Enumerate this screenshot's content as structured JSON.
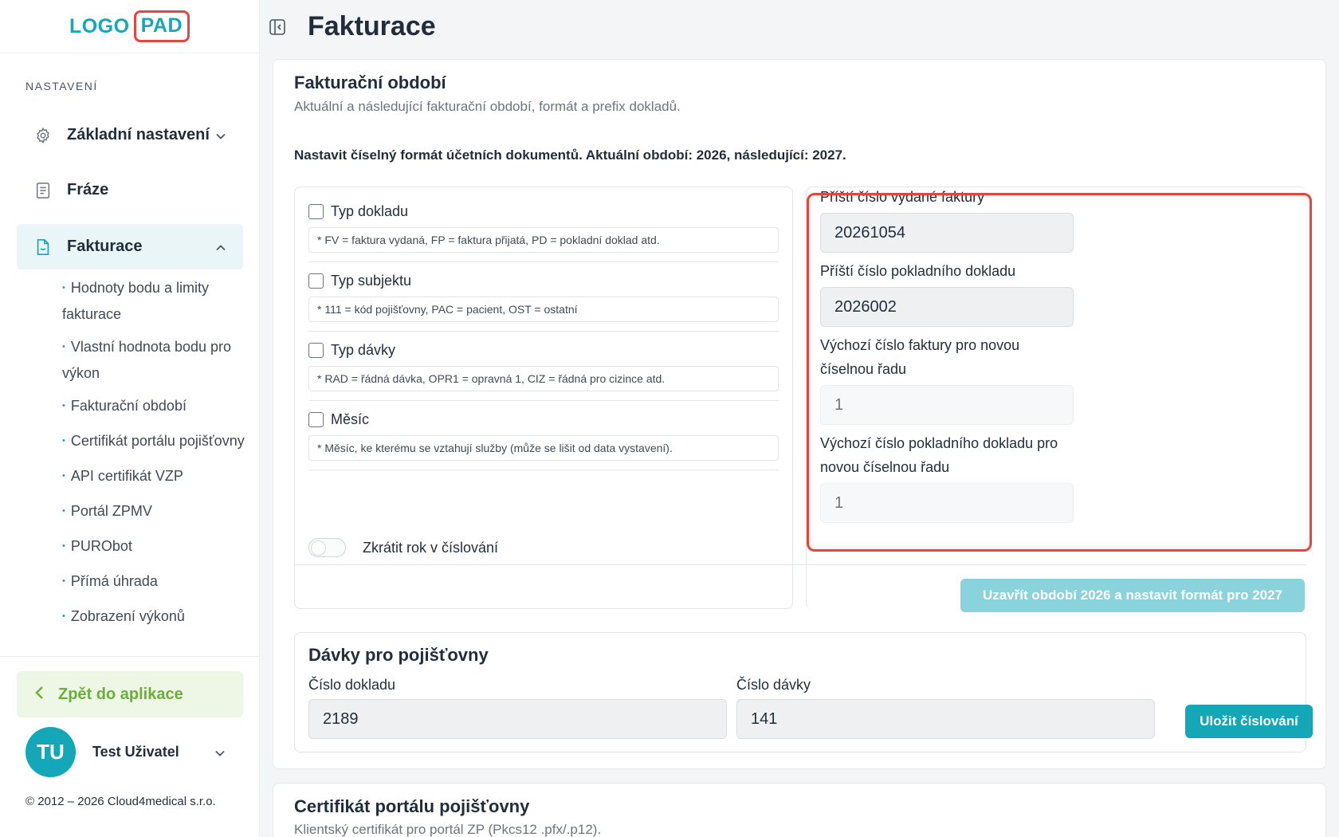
{
  "logo": {
    "part1": "LOGO",
    "part2": "PAD"
  },
  "sidebar": {
    "section_label": "NASTAVENÍ",
    "items": [
      {
        "label": "Základní nastavení",
        "icon": "gear-icon",
        "chevron": "chevron-down-icon"
      },
      {
        "label": "Fráze",
        "icon": "document-icon"
      },
      {
        "label": "Fakturace",
        "icon": "invoice-icon",
        "chevron": "chevron-up-icon",
        "active": true
      }
    ],
    "subitems": [
      "Hodnoty bodu a limity fakturace",
      "Vlastní hodnota bodu pro výkon",
      "Fakturační období",
      "Certifikát portálu pojišťovny",
      "API certifikát VZP",
      "Portál ZPMV",
      "PURObot",
      "Přímá úhrada",
      "Zobrazení výkonů"
    ],
    "back_label": "Zpět do aplikace",
    "user": {
      "initials": "TU",
      "name": "Test Uživatel"
    },
    "copyright": "© 2012 – 2026 Cloud4medical s.r.o."
  },
  "header": {
    "title": "Fakturace"
  },
  "period": {
    "title": "Fakturační období",
    "subtitle": "Aktuální a následující fakturační období, formát a prefix dokladů.",
    "note": "Nastavit číselný formát účetních dokumentů. Aktuální období: 2026, následující: 2027.",
    "format_options": [
      {
        "title": "Typ dokladu",
        "hint": "* FV = faktura vydaná, FP = faktura přijatá, PD = pokladní doklad atd.",
        "checked": false
      },
      {
        "title": "Typ subjektu",
        "hint": "* 111 = kód pojišťovny, PAC = pacient, OST = ostatní",
        "checked": false
      },
      {
        "title": "Typ dávky",
        "hint": "* RAD = řádná dávka, OPR1 = opravná 1, CIZ = řádná pro cizince atd.",
        "checked": false
      },
      {
        "title": "Měsíc",
        "hint": "* Měsíc, ke kterému se vztahují služby (může se lišit od data vystavení).",
        "checked": false
      }
    ],
    "toggle_label": "Zkrátit rok v číslování",
    "toggle_on": false,
    "numbers": {
      "next_invoice_label": "Příští číslo vydané faktury",
      "next_invoice_value": "20261054",
      "next_receipt_label": "Příští číslo pokladního dokladu",
      "next_receipt_value": "2026002",
      "default_invoice_label_1": "Výchozí číslo faktury pro novou",
      "default_invoice_label_2": "číselnou řadu",
      "default_invoice_placeholder": "1",
      "default_receipt_label_1": "Výchozí číslo pokladního dokladu pro",
      "default_receipt_label_2": "novou číselnou řadu",
      "default_receipt_placeholder": "1"
    },
    "close_button": "Uzavřít období 2026 a nastavit formát pro 2027"
  },
  "batches": {
    "title": "Dávky pro pojišťovny",
    "doc_number_label": "Číslo dokladu",
    "doc_number_value": "2189",
    "batch_number_label": "Číslo dávky",
    "batch_number_value": "141",
    "save_button": "Uložit číslování"
  },
  "certificate": {
    "title": "Certifikát portálu pojišťovny",
    "subtitle": "Klientský certifikát pro portál ZP (Pkcs12 .pfx/.p12)."
  },
  "colors": {
    "accent": "#13a7b7",
    "highlight": "#e2473f",
    "back": "#6cae3a"
  }
}
